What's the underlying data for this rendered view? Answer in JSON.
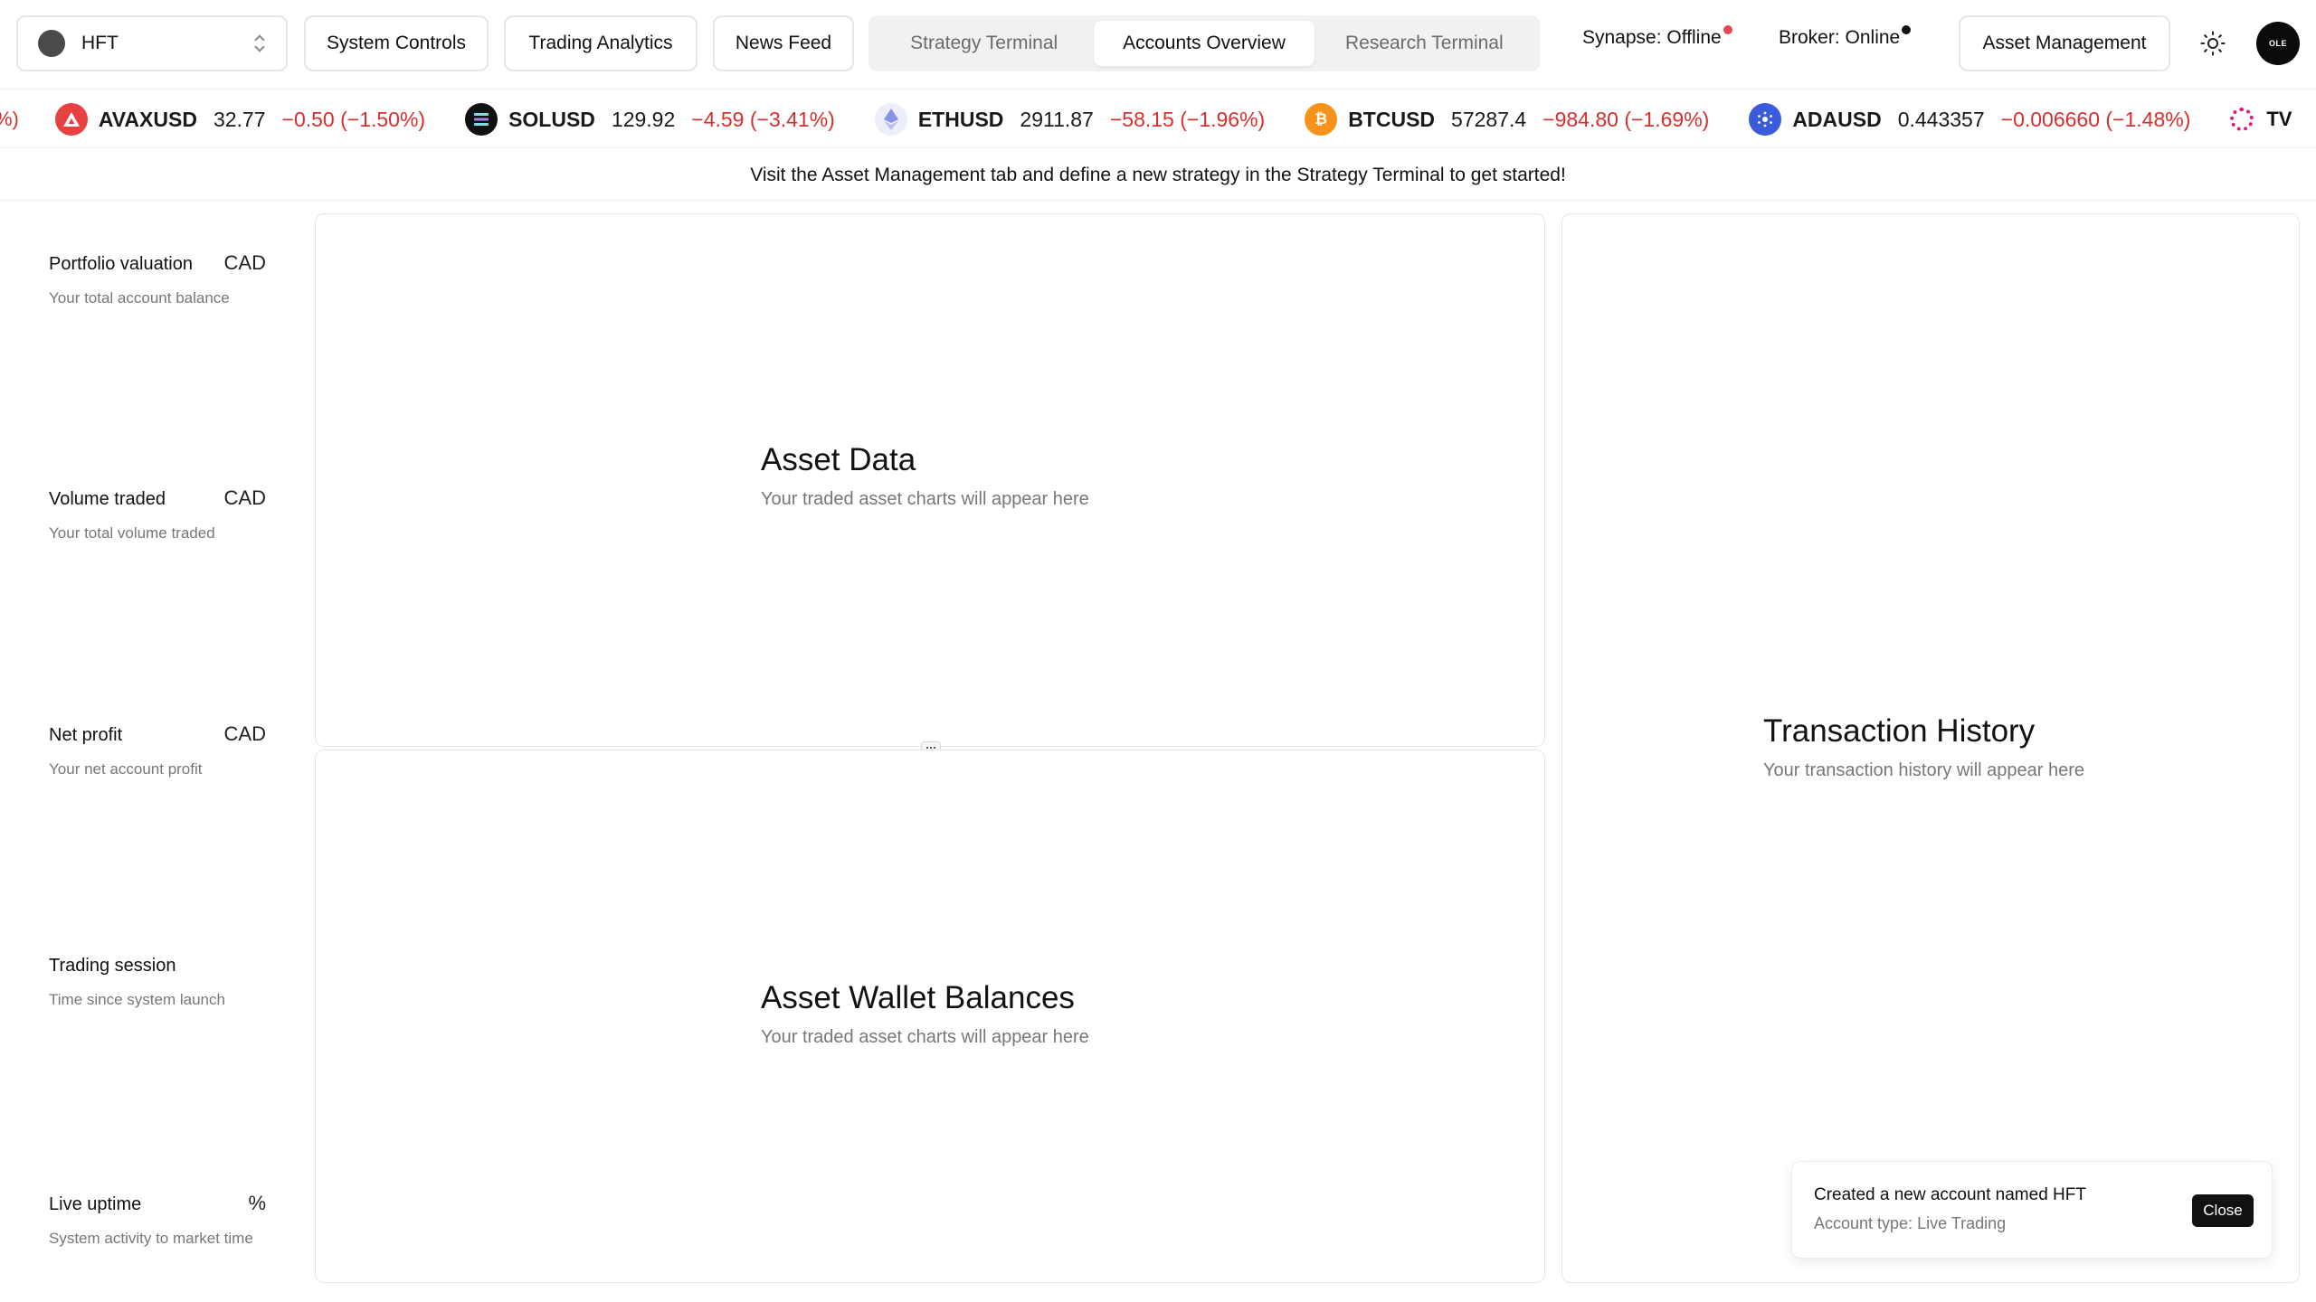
{
  "nav": {
    "account_name": "HFT",
    "system_controls": "System Controls",
    "trading_analytics": "Trading Analytics",
    "news_feed": "News Feed",
    "tabs": [
      {
        "label": "Strategy Terminal",
        "active": false
      },
      {
        "label": "Accounts Overview",
        "active": true
      },
      {
        "label": "Research Terminal",
        "active": false
      }
    ],
    "synapse_status": "Synapse: Offline",
    "broker_status": "Broker: Online",
    "asset_management": "Asset Management",
    "avatar_text": "OLE",
    "theme_icon": "sun-icon",
    "colors": {
      "offline_dot": "#e5484d",
      "online_dot": "#111111"
    }
  },
  "ticker": {
    "leading_fragment": "%)",
    "items": [
      {
        "symbol": "AVAXUSD",
        "price": "32.77",
        "change": "−0.50 (−1.50%)",
        "icon": "avax-icon",
        "color": "#e84142"
      },
      {
        "symbol": "SOLUSD",
        "price": "129.92",
        "change": "−4.59 (−3.41%)",
        "icon": "solana-icon",
        "color": "#111111"
      },
      {
        "symbol": "ETHUSD",
        "price": "2911.87",
        "change": "−58.15 (−1.96%)",
        "icon": "ethereum-icon",
        "color": "#eceefc"
      },
      {
        "symbol": "BTCUSD",
        "price": "57287.4",
        "change": "−984.80 (−1.69%)",
        "icon": "bitcoin-icon",
        "color": "#f7931a"
      },
      {
        "symbol": "ADAUSD",
        "price": "0.443357",
        "change": "−0.006660 (−1.48%)",
        "icon": "cardano-icon",
        "color": "#3b5bdb"
      }
    ],
    "trailing_fragment": "TV",
    "negative_color": "#d62f2f"
  },
  "banner": {
    "text": "Visit the Asset Management tab and define a new strategy in the Strategy Terminal to get started!"
  },
  "stats": [
    {
      "label": "Portfolio valuation",
      "unit": "CAD",
      "sub": "Your total account balance"
    },
    {
      "label": "Volume traded",
      "unit": "CAD",
      "sub": "Your total volume traded"
    },
    {
      "label": "Net profit",
      "unit": "CAD",
      "sub": "Your net account profit"
    },
    {
      "label": "Trading session",
      "unit": "",
      "sub": "Time since system launch"
    },
    {
      "label": "Live uptime",
      "unit": "%",
      "sub": "System activity to market time"
    }
  ],
  "panels": {
    "asset_data": {
      "title": "Asset Data",
      "sub": "Your traded asset charts will appear here"
    },
    "wallet": {
      "title": "Asset Wallet Balances",
      "sub": "Your traded asset charts will appear here"
    },
    "transactions": {
      "title": "Transaction History",
      "sub": "Your transaction history will appear here"
    }
  },
  "toast": {
    "title": "Created a new account named HFT",
    "sub": "Account type: Live Trading",
    "close": "Close"
  }
}
